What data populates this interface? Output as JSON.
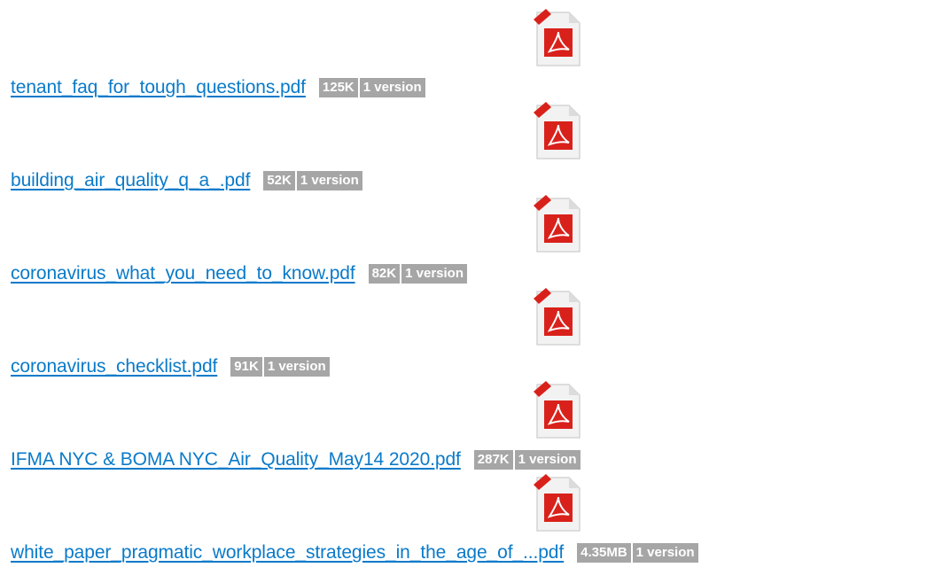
{
  "colors": {
    "link": "#0a7ac9",
    "badge_bg": "#a6a6a6",
    "badge_text": "#ffffff",
    "pdf_red": "#d9211b"
  },
  "files": [
    {
      "icon": "pdf-icon",
      "name": "tenant_faq_for_tough_questions.pdf",
      "size": "125K",
      "versions": "1 version"
    },
    {
      "icon": "pdf-icon",
      "name": "building_air_quality_q_a_.pdf",
      "size": "52K",
      "versions": "1 version"
    },
    {
      "icon": "pdf-icon",
      "name": "coronavirus_what_you_need_to_know.pdf",
      "size": "82K",
      "versions": "1 version"
    },
    {
      "icon": "pdf-icon",
      "name": "coronavirus_checklist.pdf",
      "size": "91K",
      "versions": "1 version"
    },
    {
      "icon": "pdf-icon",
      "name": "IFMA NYC & BOMA NYC_Air_Quality_May14 2020.pdf",
      "size": "287K",
      "versions": "1 version"
    },
    {
      "icon": "pdf-icon",
      "name": "white_paper_pragmatic_workplace_strategies_in_the_age_of_...pdf",
      "size": "4.35MB",
      "versions": "1 version"
    }
  ]
}
